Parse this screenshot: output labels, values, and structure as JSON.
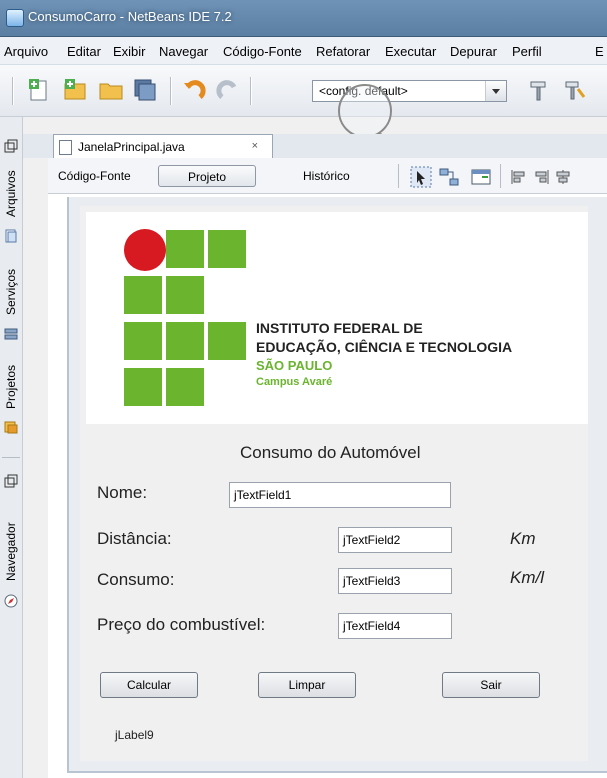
{
  "window": {
    "title": "ConsumoCarro - NetBeans IDE 7.2"
  },
  "menu": [
    "Arquivo",
    "Editar",
    "Exibir",
    "Navegar",
    "Código-Fonte",
    "Refatorar",
    "Executar",
    "Depurar",
    "Perfil",
    "E"
  ],
  "toolbar": {
    "config_value": "<config. default>"
  },
  "side_panels": [
    "Arquivos",
    "Serviços",
    "Projetos",
    "Navegador"
  ],
  "editor": {
    "file_tab": "JanelaPrincipal.java",
    "tab_close": "×",
    "view_tabs": [
      "Código-Fonte",
      "Projeto",
      "Histórico"
    ],
    "active_view": "Projeto"
  },
  "logo": {
    "line1": "INSTITUTO FEDERAL DE",
    "line2": "EDUCAÇÃO, CIÊNCIA E TECNOLOGIA",
    "line3": "SÃO PAULO",
    "line4": "Campus Avaré",
    "green": "#6ab42e",
    "red": "#d71921"
  },
  "form": {
    "heading": "Consumo do Automóvel",
    "nome_label": "Nome:",
    "nome_value": "jTextField1",
    "distancia_label": "Distância:",
    "distancia_value": "jTextField2",
    "distancia_unit": "Km",
    "consumo_label": "Consumo:",
    "consumo_value": "jTextField3",
    "consumo_unit": "Km/l",
    "preco_label": "Preço do combustível:",
    "preco_value": "jTextField4",
    "btn_calcular": "Calcular",
    "btn_limpar": "Limpar",
    "btn_sair": "Sair",
    "result_label": "jLabel9"
  }
}
